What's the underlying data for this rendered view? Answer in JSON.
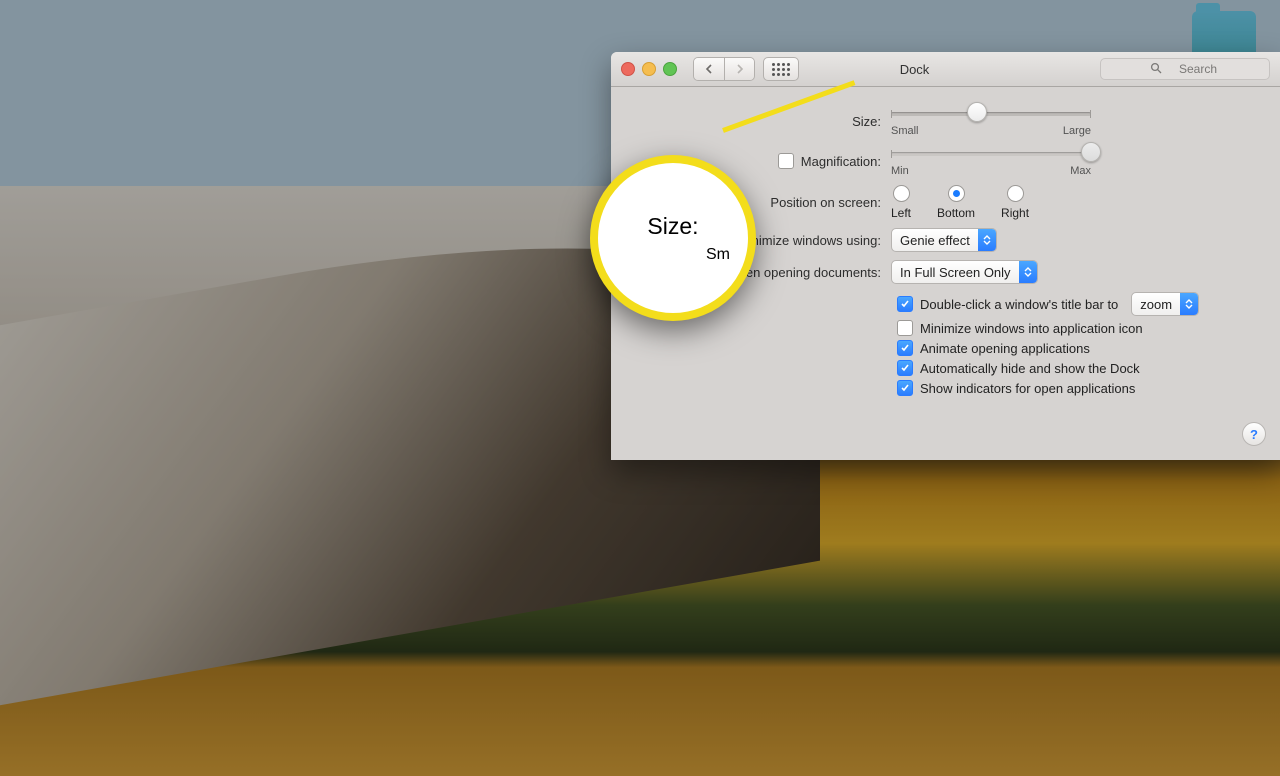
{
  "window": {
    "title": "Dock",
    "search_placeholder": "Search"
  },
  "settings": {
    "size": {
      "label": "Size:",
      "min_label": "Small",
      "max_label": "Large",
      "value_percent": 43
    },
    "magnification": {
      "label": "Magnification:",
      "min_label": "Min",
      "max_label": "Max",
      "checked": false,
      "value_percent": 100
    },
    "position": {
      "label": "Position on screen:",
      "options": {
        "left": "Left",
        "bottom": "Bottom",
        "right": "Right"
      },
      "selected": "bottom"
    },
    "minimize_using": {
      "label": "Minimize windows using:",
      "value": "Genie effect"
    },
    "prefer_tabs": {
      "label": "Prefer tabs when opening documents:",
      "value": "In Full Screen Only"
    },
    "double_click": {
      "checked": true,
      "label_before": "Double-click a window's title bar to",
      "value": "zoom"
    },
    "minimize_into_icon": {
      "checked": false,
      "label": "Minimize windows into application icon"
    },
    "animate": {
      "checked": true,
      "label": "Animate opening applications"
    },
    "autohide": {
      "checked": true,
      "label": "Automatically hide and show the Dock"
    },
    "indicators": {
      "checked": true,
      "label": "Show indicators for open applications"
    }
  },
  "callout": {
    "big": "Size:",
    "sub": "Sm"
  },
  "help": "?"
}
